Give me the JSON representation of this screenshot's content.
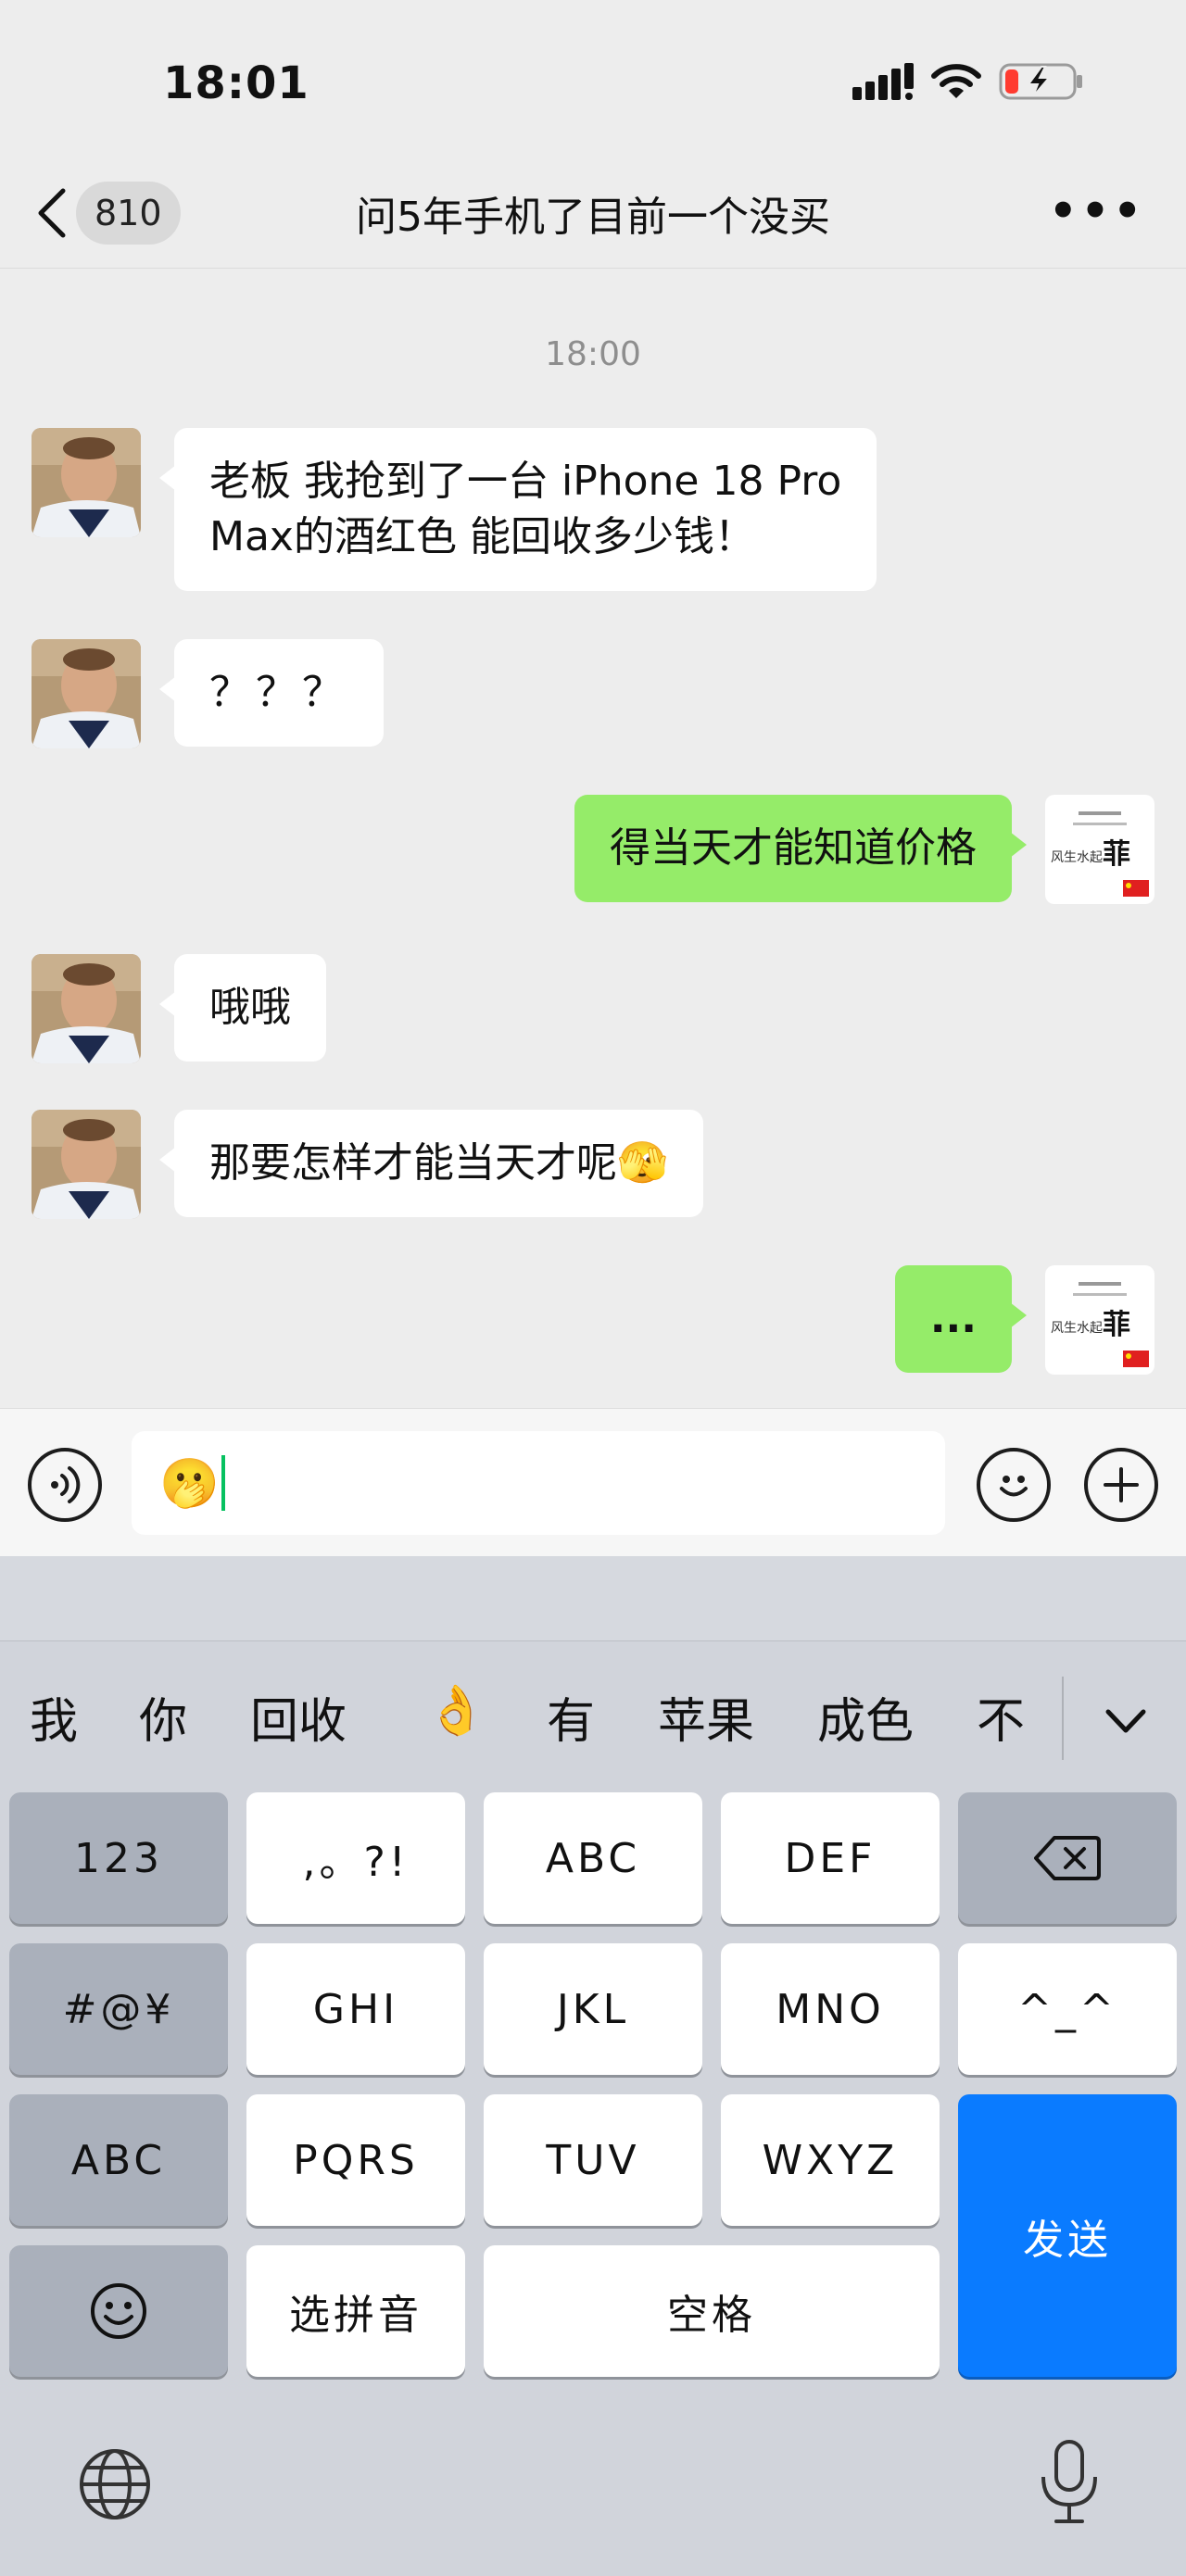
{
  "status_bar": {
    "time": "18:01"
  },
  "nav": {
    "back_badge": "810",
    "title": "问5年手机了目前一个没买",
    "more": "•••"
  },
  "chat": {
    "timestamp": "18:00",
    "messages": [
      {
        "side": "left",
        "lines": [
          "老板 我抢到了一台 iPhone 18 Pro",
          "Max的酒红色 能回收多少钱！"
        ]
      },
      {
        "side": "left",
        "text": "？？？"
      },
      {
        "side": "right",
        "text": "得当天才能知道价格"
      },
      {
        "side": "left",
        "text": "哦哦"
      },
      {
        "side": "left",
        "text": "那要怎样才能当天才呢"
      },
      {
        "side": "right",
        "text": "..."
      }
    ],
    "thinking_emoji": "🫣"
  },
  "input": {
    "value": "🫢"
  },
  "keyboard": {
    "candidates": [
      "我",
      "你",
      "回收",
      "👌",
      "有",
      "苹果",
      "成色",
      "不"
    ],
    "keys": {
      "num": "123",
      "punct": ",。?!",
      "abc": "ABC",
      "def": "DEF",
      "symbols": "#@¥",
      "ghi": "GHI",
      "jkl": "JKL",
      "mno": "MNO",
      "emoticon": "^_^",
      "abc_mode": "ABC",
      "pqrs": "PQRS",
      "tuv": "TUV",
      "wxyz": "WXYZ",
      "send": "发送",
      "pinyin": "选拼音",
      "space": "空格"
    }
  },
  "colors": {
    "bg": "#ededed",
    "sent_bubble": "#95ec69",
    "received_bubble": "#ffffff",
    "send_key": "#0a7bff",
    "keyboard_bg": "#d1d4db"
  }
}
